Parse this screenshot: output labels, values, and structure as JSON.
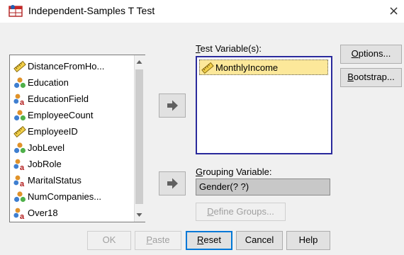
{
  "window": {
    "title": "Independent-Samples T Test",
    "close_glyph": "×"
  },
  "source_list": {
    "items": [
      {
        "label": "DistanceFromHo...",
        "icon": "scale-ruler-icon"
      },
      {
        "label": "Education",
        "icon": "ordinal-bars-icon"
      },
      {
        "label": "EducationField",
        "icon": "nominal-string-icon"
      },
      {
        "label": "EmployeeCount",
        "icon": "ordinal-bars-icon"
      },
      {
        "label": "EmployeeID",
        "icon": "scale-ruler-icon"
      },
      {
        "label": "JobLevel",
        "icon": "ordinal-bars-icon"
      },
      {
        "label": "JobRole",
        "icon": "nominal-string-icon"
      },
      {
        "label": "MaritalStatus",
        "icon": "nominal-string-icon"
      },
      {
        "label": "NumCompanies...",
        "icon": "ordinal-bars-icon"
      },
      {
        "label": "Over18",
        "icon": "nominal-string-icon"
      }
    ]
  },
  "test_variables": {
    "label_prefix_u": "T",
    "label_rest": "est Variable(s):",
    "items": [
      {
        "label": "MonthlyIncome",
        "icon": "scale-ruler-icon"
      }
    ]
  },
  "grouping": {
    "label_prefix_u": "G",
    "label_rest": "rouping Variable:",
    "value": "Gender(? ?)",
    "define_u": "D",
    "define_rest": "efine Groups..."
  },
  "side_buttons": {
    "options_u": "O",
    "options_rest": "ptions...",
    "bootstrap_u": "B",
    "bootstrap_rest": "ootstrap..."
  },
  "bottom_buttons": {
    "ok": "OK",
    "paste_u": "P",
    "paste_rest": "aste",
    "reset_u": "R",
    "reset_rest": "eset",
    "cancel": "Cancel",
    "help": "Help"
  },
  "colors": {
    "selection": "#fce89a",
    "focus_border": "#0078d7",
    "list_border": "#2a2a9c"
  }
}
